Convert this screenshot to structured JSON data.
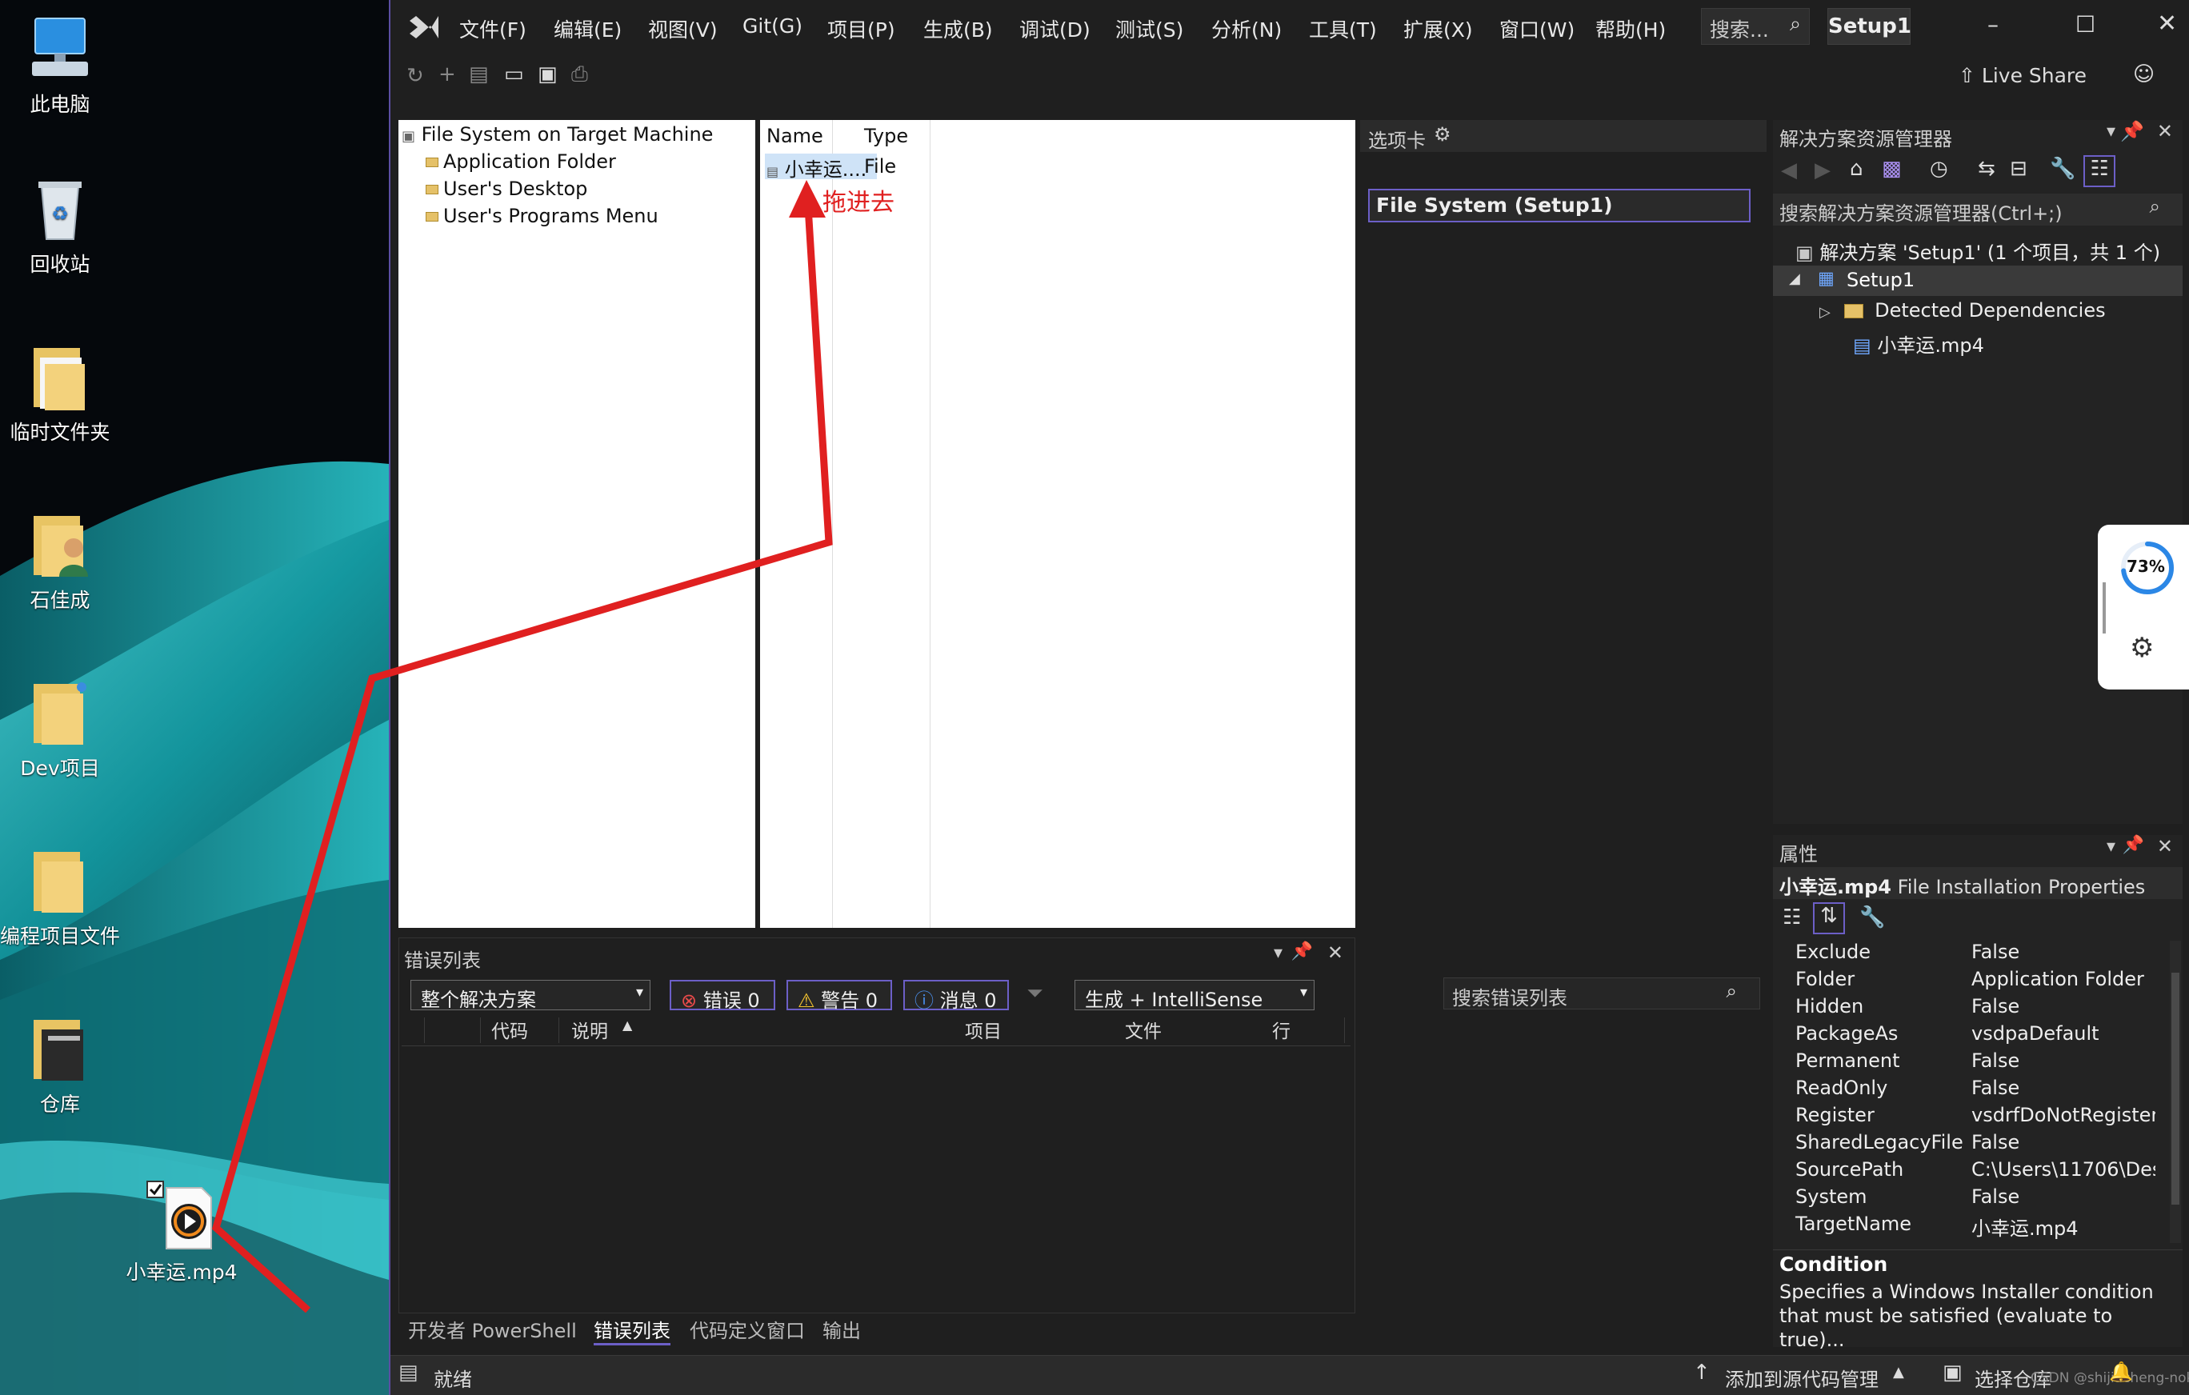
{
  "desktop": {
    "icons": [
      {
        "label": "此电脑",
        "icon": "computer-icon"
      },
      {
        "label": "回收站",
        "icon": "recycle-bin-icon"
      },
      {
        "label": "临时文件夹",
        "icon": "folder-icon"
      },
      {
        "label": "石佳成",
        "icon": "user-folder-icon"
      },
      {
        "label": "Dev项目",
        "icon": "folder-icon"
      },
      {
        "label": "编程项目文件",
        "icon": "folder-icon"
      },
      {
        "label": "仓库",
        "icon": "folder-icon"
      },
      {
        "label": "小幸运.mp4",
        "icon": "video-file-icon"
      }
    ]
  },
  "vs": {
    "menu": [
      "文件(F)",
      "编辑(E)",
      "视图(V)",
      "Git(G)",
      "项目(P)",
      "生成(B)",
      "调试(D)",
      "测试(S)",
      "分析(N)",
      "工具(T)",
      "扩展(X)",
      "窗口(W)",
      "帮助(H)"
    ],
    "search_placeholder": "搜索...",
    "solution_badge": "Setup1",
    "live_share": "Live Share",
    "fs_tree": {
      "root": "File System on Target Machine",
      "children": [
        "Application Folder",
        "User's Desktop",
        "User's Programs Menu"
      ]
    },
    "fs_list": {
      "headers": [
        "Name",
        "Type"
      ],
      "rows": [
        {
          "name": "小幸运....",
          "type": "File"
        }
      ]
    },
    "annotation": "拖进去",
    "toolbox": {
      "title": "选项卡",
      "item": "File System (Setup1)"
    },
    "solution_explorer": {
      "title": "解决方案资源管理器",
      "search": "搜索解决方案资源管理器(Ctrl+;)",
      "solution": "解决方案 'Setup1' (1 个项目，共 1 个)",
      "project": "Setup1",
      "items": [
        "Detected Dependencies",
        "小幸运.mp4"
      ]
    },
    "progress_widget": {
      "percent": "73%"
    },
    "error_list": {
      "title": "错误列表",
      "scope": "整个解决方案",
      "errors": "错误 0",
      "warnings": "警告 0",
      "messages": "消息 0",
      "build_filter": "生成 + IntelliSense",
      "search": "搜索错误列表",
      "columns": [
        "代码",
        "说明",
        "项目",
        "文件",
        "行"
      ]
    },
    "bottom_tabs": [
      "开发者 PowerShell",
      "错误列表",
      "代码定义窗口",
      "输出"
    ],
    "properties": {
      "title": "属性",
      "object": "小幸运.mp4",
      "object_type": "File Installation Properties",
      "rows": [
        {
          "k": "Exclude",
          "v": "False"
        },
        {
          "k": "Folder",
          "v": "Application Folder"
        },
        {
          "k": "Hidden",
          "v": "False"
        },
        {
          "k": "PackageAs",
          "v": "vsdpaDefault"
        },
        {
          "k": "Permanent",
          "v": "False"
        },
        {
          "k": "ReadOnly",
          "v": "False"
        },
        {
          "k": "Register",
          "v": "vsdrfDoNotRegister"
        },
        {
          "k": "SharedLegacyFile",
          "v": "False"
        },
        {
          "k": "SourcePath",
          "v": "C:\\Users\\11706\\Des"
        },
        {
          "k": "System",
          "v": "False"
        },
        {
          "k": "TargetName",
          "v": "小幸运.mp4"
        }
      ],
      "desc_title": "Condition",
      "desc_text": "Specifies a Windows Installer condition that must be satisfied (evaluate to true)..."
    },
    "status": {
      "ready": "就绪",
      "add_source": "添加到源代码管理",
      "select_repo": "选择仓库",
      "watermark": "CSDN @shijiacheng-nok"
    }
  },
  "colors": {
    "accent": "#6c5fc7",
    "annotation_red": "#e02020",
    "vs_bg": "#1f1f1f"
  }
}
